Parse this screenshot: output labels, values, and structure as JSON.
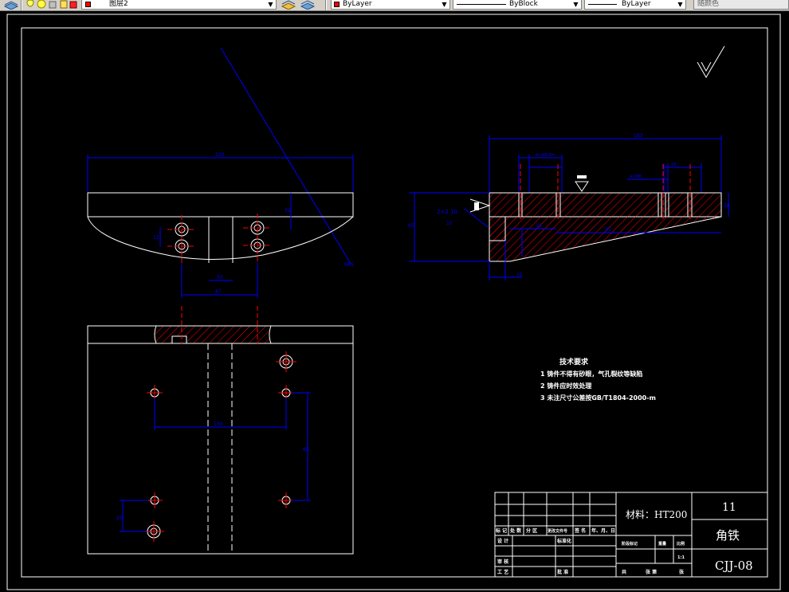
{
  "toolbar": {
    "layer_name": "图层2",
    "color_value": "ByLayer",
    "linetype_value": "ByBlock",
    "lineweight_value": "ByLayer",
    "plotstyle_value": "随颜色",
    "colors": {
      "face": "#d4d0c8",
      "byLayer_swatch": "#ff0000"
    }
  },
  "drawing": {
    "tech_requirements": {
      "title": "技术要求",
      "items": [
        "1  铸件不得有砂眼，气孔裂纹等缺陷",
        "2  铸件应时效处理",
        "3  未注尺寸公差按GB/T1804-2000-m"
      ]
    },
    "dimensions": {
      "top_width": "210",
      "height_a": "32",
      "hole_a": "12",
      "hole_b": "22",
      "span_inner": "50",
      "span_outer": "87",
      "right_total": "163",
      "right_sub1": "4×M8-6H",
      "right_sub2": "4×M8",
      "right_sub3": "18",
      "right_h1": "25",
      "right_h2": "65",
      "right_base": "18",
      "right_len": "85",
      "right_w": "28",
      "right_b": "15",
      "left_small": "16",
      "slot": "2×2 10",
      "slot2": "15",
      "bottom_span": "100",
      "bottom_h": "85",
      "bottom_h2": "25",
      "radius": "R65"
    },
    "title_block": {
      "material": "材料：HT200",
      "quantity": "11",
      "part_name": "角铁",
      "drawing_no": "CJJ-08",
      "header_cells": [
        "标 记",
        "处 数",
        "分  区",
        "更改文件号",
        "签 名",
        "年、月、日"
      ],
      "left_labels": [
        "设 计",
        "审 核",
        "工 艺"
      ],
      "mid_labels": [
        "标准化",
        "批 准"
      ],
      "stage_labels": [
        "阶段标记",
        "重量",
        "比例"
      ],
      "scale": "1:1",
      "sheet_labels": [
        "共",
        "张  第",
        "张"
      ]
    },
    "colors": {
      "background": "#000000",
      "outline": "#ffffff",
      "dimension": "#0000ff",
      "center": "#ff0000",
      "hatch": "#ff0000"
    }
  }
}
